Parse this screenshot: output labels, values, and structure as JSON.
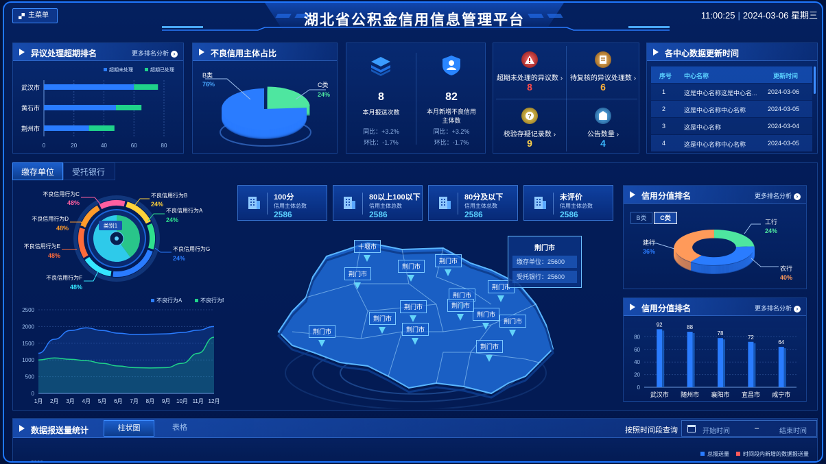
{
  "header": {
    "menu_label": "主菜单",
    "title": "湖北省公积金信用信息管理平台",
    "time": "11:00:25",
    "date": "2024-03-06",
    "weekday": "星期三"
  },
  "panel_dispute": {
    "title": "异议处理超期排名",
    "more": "更多排名分析",
    "legend": [
      "超期未处理",
      "超期已处理"
    ],
    "chart_data": {
      "type": "bar",
      "orientation": "horizontal",
      "stacked": true,
      "categories": [
        "武汉市",
        "黄石市",
        "荆州市"
      ],
      "series": [
        {
          "name": "超期未处理",
          "values": [
            60,
            48,
            30
          ],
          "color": "#2a7cff"
        },
        {
          "name": "超期已处理",
          "values": [
            16,
            17,
            17
          ],
          "color": "#1fd28a"
        }
      ],
      "xticks": [
        "0",
        "20",
        "40",
        "60",
        "80"
      ],
      "xlim": [
        0,
        80
      ]
    }
  },
  "panel_bad": {
    "title": "不良信用主体占比",
    "chart_data": {
      "type": "pie",
      "labels": [
        "B类",
        "C类"
      ],
      "values": [
        76,
        24
      ],
      "display": [
        "76%",
        "24%"
      ],
      "colors": [
        "#2a7cff",
        "#4ee6a0"
      ]
    }
  },
  "panel_send": {
    "items": [
      {
        "value": "8",
        "label": "本月报送次数",
        "yoy": "同比：+3.2%",
        "mom": "环比：-1.7%"
      },
      {
        "value": "82",
        "label": "本月新增不良信用主体数",
        "yoy": "同比：+3.2%",
        "mom": "环比：-1.7%"
      }
    ]
  },
  "panel_alerts": {
    "items": [
      {
        "label": "超期未处理的异议数",
        "value": "8",
        "color": "#ff4a4a",
        "icon": "warning-icon"
      },
      {
        "label": "待复核的异议处理数",
        "value": "6",
        "color": "#ffb13a",
        "icon": "document-icon"
      },
      {
        "label": "校验存疑记录数",
        "value": "9",
        "color": "#ffd24a",
        "icon": "question-icon"
      },
      {
        "label": "公告数量",
        "value": "4",
        "color": "#3ab8ff",
        "icon": "notice-icon"
      }
    ]
  },
  "panel_update": {
    "title": "各中心数据更新时间",
    "columns": [
      "序号",
      "中心名称",
      "更新时间"
    ],
    "rows": [
      [
        "1",
        "这是中心名称这是中心名...",
        "2024-03-06"
      ],
      [
        "2",
        "这是中心名称中心名称",
        "2024-03-05"
      ],
      [
        "3",
        "这是中心名称",
        "2024-03-04"
      ],
      [
        "4",
        "这是中心名称中心名称",
        "2024-03-05"
      ]
    ]
  },
  "tabs": [
    "缴存单位",
    "受托银行"
  ],
  "donut": {
    "center": "类别1",
    "chart_data": {
      "type": "pie",
      "labels": [
        "不良信用行为C",
        "不良信用行为B",
        "不良信用行为A",
        "不良信用行为G",
        "不良信用行为F",
        "不良信用行为E",
        "不良信用行为D"
      ],
      "display": [
        "48%",
        "24%",
        "24%",
        "24%",
        "48%",
        "48%",
        "48%"
      ],
      "colors": [
        "#ff5fa0",
        "#ffd23a",
        "#2fe08e",
        "#2a7cff",
        "#35e6ff",
        "#ff6b3a",
        "#ff9a2a"
      ]
    }
  },
  "line_chart": {
    "chart_data": {
      "type": "line",
      "categories": [
        "1月",
        "2月",
        "3月",
        "4月",
        "5月",
        "6月",
        "7月",
        "8月",
        "9月",
        "10月",
        "11月",
        "12月"
      ],
      "series": [
        {
          "name": "不良行为A",
          "values": [
            1200,
            1620,
            1880,
            1960,
            1880,
            1800,
            1760,
            1770,
            1780,
            1820,
            1890,
            2000
          ],
          "color": "#2a7cff"
        },
        {
          "name": "不良行为B",
          "values": [
            1000,
            1060,
            1020,
            980,
            900,
            820,
            770,
            760,
            770,
            900,
            1200,
            1680
          ],
          "color": "#1fd28a"
        }
      ],
      "yticks": [
        "0",
        "500",
        "1000",
        "1500",
        "2000",
        "2500"
      ],
      "ylim": [
        0,
        2500
      ]
    }
  },
  "stats": [
    {
      "title": "100分",
      "sub": "信用主体总数",
      "value": "2586"
    },
    {
      "title": "80以上100以下",
      "sub": "信用主体总数",
      "value": "2586"
    },
    {
      "title": "80分及以下",
      "sub": "信用主体总数",
      "value": "2586"
    },
    {
      "title": "未评价",
      "sub": "信用主体总数",
      "value": "2586"
    }
  ],
  "map": {
    "labels": [
      "十堰市",
      "荆门市",
      "荆门市",
      "荆门市",
      "荆门市",
      "荆门市",
      "荆门市",
      "荆门市",
      "荆门市",
      "荆门市",
      "荆门市",
      "荆门市",
      "荆门市",
      "荆门市"
    ],
    "tooltip": {
      "title": "荆门市",
      "line1": "缴存单位：25600",
      "line2": "受托银行：25600"
    }
  },
  "score_rank": {
    "title": "信用分值排名",
    "more": "更多排名分析",
    "tabs": [
      "B类",
      "C类"
    ],
    "chart_data": {
      "type": "pie",
      "labels": [
        "工行",
        "建行",
        "农行"
      ],
      "display": [
        "24%",
        "36%",
        "40%"
      ],
      "values": [
        24,
        36,
        40
      ],
      "colors": [
        "#4ee6a0",
        "#2a7cff",
        "#ff9a5a"
      ]
    }
  },
  "score_bar": {
    "title": "信用分值排名",
    "more": "更多排名分析",
    "chart_data": {
      "type": "bar",
      "categories": [
        "武汉市",
        "随州市",
        "襄阳市",
        "宜昌市",
        "咸宁市"
      ],
      "values": [
        92,
        88,
        78,
        72,
        64
      ],
      "yticks": [
        "0",
        "20",
        "40",
        "60",
        "80"
      ],
      "ylim": [
        0,
        100
      ]
    }
  },
  "bottom": {
    "title": "数据报送量统计",
    "tabs": [
      "柱状图",
      "表格"
    ],
    "query_label": "按照时间段查询",
    "start_placeholder": "开始时间",
    "dash": "–",
    "end_placeholder": "结束时间",
    "legend": [
      "总报送量",
      "时间段内新增的数据报送量"
    ],
    "ytop": "3000"
  }
}
